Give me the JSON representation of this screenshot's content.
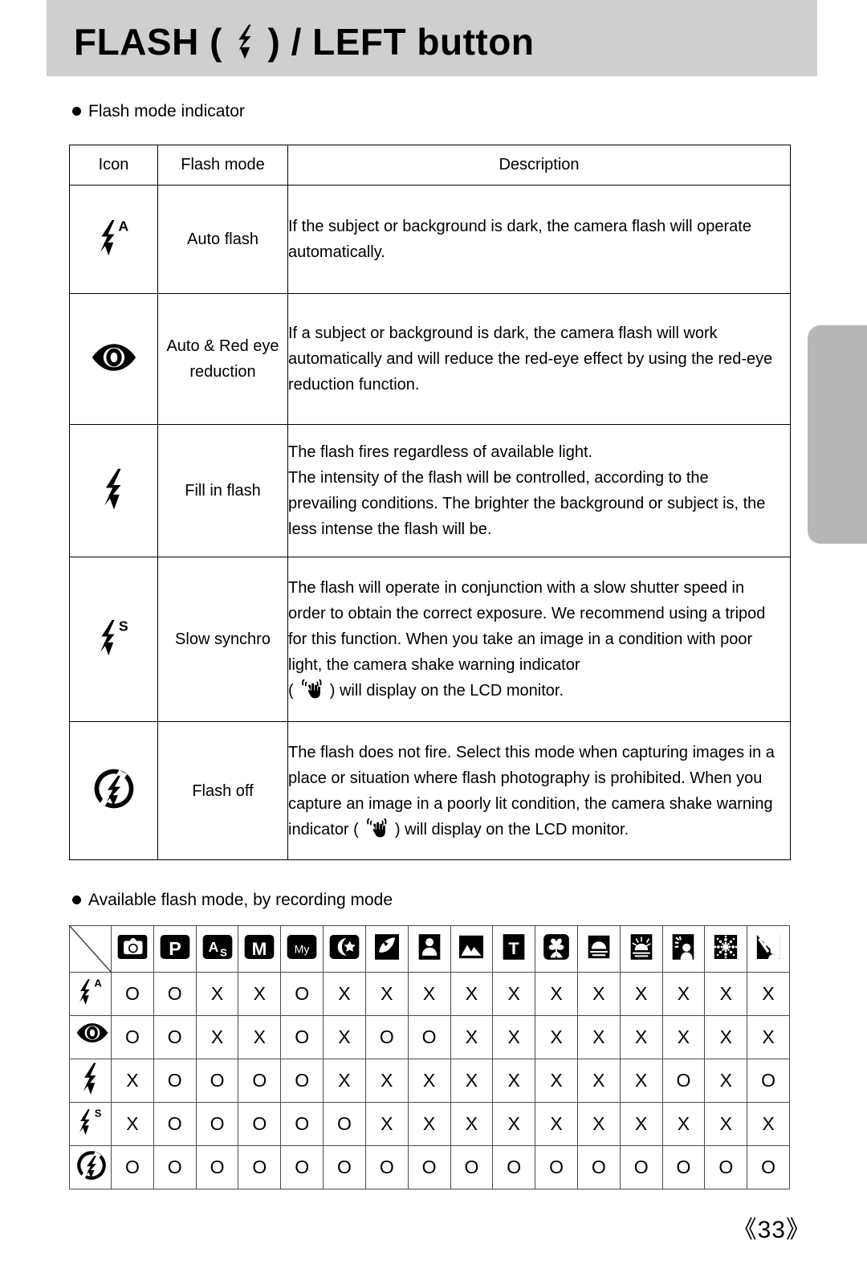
{
  "header": {
    "title_before": "FLASH (",
    "title_glyph": "flash-bolt-icon",
    "title_after": ") / LEFT button"
  },
  "sections": {
    "flash_mode_indicator_heading": "Flash mode indicator",
    "available_flash_mode_heading": "Available flash mode, by recording mode"
  },
  "flash_mode_table": {
    "columns": [
      "Icon",
      "Flash mode",
      "Description"
    ],
    "rows": [
      {
        "icon": "flash-auto-icon",
        "mode_lines": [
          "Auto flash"
        ],
        "desc_lines": [
          "If the subject or background is dark, the camera flash will operate",
          "automatically."
        ]
      },
      {
        "icon": "red-eye-icon",
        "mode_lines": [
          "Auto &",
          "Red eye",
          "reduction"
        ],
        "desc_lines": [
          "If a subject or background is dark, the camera flash will work",
          "automatically and will reduce the red-eye effect by using the red-eye",
          "reduction function."
        ]
      },
      {
        "icon": "flash-fill-icon",
        "mode_lines": [
          "Fill in flash"
        ],
        "desc_lines": [
          "The flash fires regardless of available light.",
          "The intensity of the flash will be controlled, according to the",
          "prevailing conditions. The brighter the background or subject is, the",
          "less intense the flash will be."
        ]
      },
      {
        "icon": "flash-slow-synchro-icon",
        "mode_lines": [
          "Slow synchro"
        ],
        "desc_lines": [
          "The flash will operate in conjunction with a slow shutter speed in",
          "order to obtain the correct exposure. We recommend using a tripod",
          "for this function. When you take an image in a condition with poor",
          "light, the camera shake warning indicator"
        ],
        "desc_last_prefix": "( ",
        "desc_last_glyph": "camera-shake-icon",
        "desc_last_suffix": " ) will display on the LCD monitor."
      },
      {
        "icon": "flash-off-icon",
        "mode_lines": [
          "Flash off"
        ],
        "desc_lines": [
          "The flash does not fire. Select this mode when capturing images in a",
          "place or situation where flash photography is prohibited. When you",
          "capture an image in a poorly lit condition, the camera shake warning"
        ],
        "desc_last_prefix": "indicator ( ",
        "desc_last_glyph": "camera-shake-icon",
        "desc_last_suffix": " ) will display on the LCD monitor."
      }
    ]
  },
  "availability_matrix": {
    "corner": "diagonal-slash",
    "column_icons": [
      "auto-mode-icon",
      "program-mode-icon",
      "aperture-shutter-priority-icon",
      "manual-mode-icon",
      "my-set-mode-icon",
      "night-scene-icon",
      "portrait-scene-icon",
      "children-scene-icon",
      "landscape-scene-icon",
      "text-scene-icon",
      "close-up-scene-icon",
      "sunset-scene-icon",
      "dawn-scene-icon",
      "backlight-scene-icon",
      "fireworks-scene-icon",
      "beach-snow-scene-icon"
    ],
    "row_icons": [
      "flash-auto-icon",
      "red-eye-icon",
      "flash-fill-icon",
      "flash-slow-synchro-icon",
      "flash-off-icon"
    ],
    "values": [
      [
        "O",
        "O",
        "X",
        "X",
        "O",
        "X",
        "X",
        "X",
        "X",
        "X",
        "X",
        "X",
        "X",
        "X",
        "X",
        "X"
      ],
      [
        "O",
        "O",
        "X",
        "X",
        "O",
        "X",
        "O",
        "O",
        "X",
        "X",
        "X",
        "X",
        "X",
        "X",
        "X",
        "X"
      ],
      [
        "X",
        "O",
        "O",
        "O",
        "O",
        "X",
        "X",
        "X",
        "X",
        "X",
        "X",
        "X",
        "X",
        "O",
        "X",
        "O"
      ],
      [
        "X",
        "O",
        "O",
        "O",
        "O",
        "O",
        "X",
        "X",
        "X",
        "X",
        "X",
        "X",
        "X",
        "X",
        "X",
        "X"
      ],
      [
        "O",
        "O",
        "O",
        "O",
        "O",
        "O",
        "O",
        "O",
        "O",
        "O",
        "O",
        "O",
        "O",
        "O",
        "O",
        "O"
      ]
    ]
  },
  "footer": {
    "page_number": "《33》"
  },
  "colors": {
    "banner_gray": "#cfcfcf",
    "index_tab_gray": "#b7b7b7",
    "ink": "#000000",
    "table_rule": "#4a4a4a"
  }
}
